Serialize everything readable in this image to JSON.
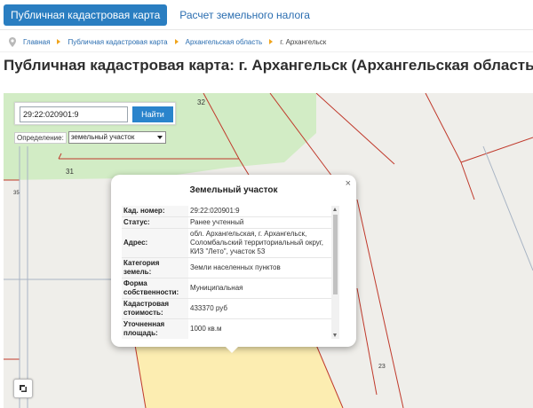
{
  "tabs": [
    {
      "label": "Публичная кадастровая карта",
      "active": true
    },
    {
      "label": "Расчет земельного налога",
      "active": false
    }
  ],
  "breadcrumb": {
    "items": [
      "Главная",
      "Публичная кадастровая карта",
      "Архангельская область"
    ],
    "current": "г. Архангельск"
  },
  "page_title": "Публичная кадастровая карта: г. Архангельск (Архангельская область)",
  "search": {
    "value": "29:22:020901:9",
    "button_label": "Найти"
  },
  "definition": {
    "label": "Определение:",
    "selected": "земельный участок"
  },
  "map": {
    "parcel_numbers": [
      "32",
      "31",
      "35",
      "23"
    ],
    "colors": {
      "background": "#efeeea",
      "green_area": "#d2ecc5",
      "yellow_parcel": "#fcedb1",
      "boundary": "#c0392b"
    }
  },
  "popup": {
    "title": "Земельный участок",
    "close_symbol": "×",
    "rows": [
      {
        "key": "Кад. номер:",
        "value": "29:22:020901:9"
      },
      {
        "key": "Статус:",
        "value": "Ранее учтенный"
      },
      {
        "key": "Адрес:",
        "value": "обл. Архангельская, г. Архангельск, Соломбальский территориальный округ, КИЗ \"Лето\", участок 53"
      },
      {
        "key": "Категория земель:",
        "value": "Земли населенных пунктов"
      },
      {
        "key": "Форма собственности:",
        "value": "Муниципальная"
      },
      {
        "key": "Кадастровая стоимость:",
        "value": "433370 руб"
      },
      {
        "key": "Уточненная площадь:",
        "value": "1000 кв.м"
      }
    ]
  }
}
